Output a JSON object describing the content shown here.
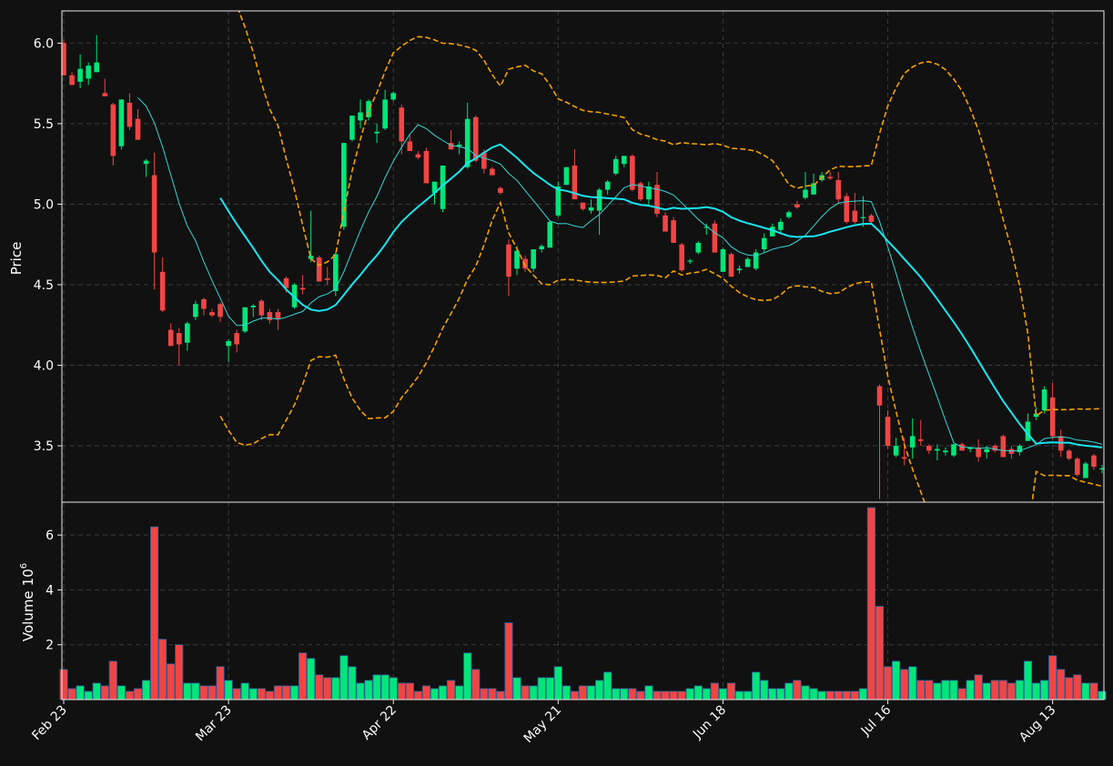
{
  "chart_data": {
    "type": "candlestick",
    "colors": {
      "background": "#111111",
      "up": "#00e67a",
      "down": "#f04545",
      "ma_fast": "#36d6d6",
      "ma_slow": "#19e5f0",
      "bollinger": "#f5a000",
      "grid": "#3a3a3a"
    },
    "price_panel": {
      "ylabel": "Price",
      "ylim": [
        3.15,
        6.2
      ],
      "yticks": [
        3.5,
        4.0,
        4.5,
        5.0,
        5.5,
        6.0
      ],
      "ytick_labels": [
        "3.5",
        "4.0",
        "4.5",
        "5.0",
        "5.5",
        "6.0"
      ]
    },
    "volume_panel": {
      "ylabel": "Volume",
      "ylabel_exp": "6",
      "ylim": [
        0,
        7.0
      ],
      "yticks": [
        2,
        4,
        6
      ],
      "ytick_labels": [
        "2",
        "4",
        "6"
      ]
    },
    "x_tick_labels": [
      {
        "index": 0,
        "label": "Feb 23"
      },
      {
        "index": 20,
        "label": "Mar 23"
      },
      {
        "index": 40,
        "label": "Apr 22"
      },
      {
        "index": 60,
        "label": "May 21"
      },
      {
        "index": 80,
        "label": "Jun 18"
      },
      {
        "index": 100,
        "label": "Jul 16"
      },
      {
        "index": 120,
        "label": "Aug 13"
      }
    ],
    "candles": [
      [
        6.0,
        6.02,
        5.8,
        5.8,
        1.1
      ],
      [
        5.8,
        5.82,
        5.74,
        5.74,
        0.4
      ],
      [
        5.76,
        5.93,
        5.72,
        5.84,
        0.5
      ],
      [
        5.78,
        5.88,
        5.74,
        5.86,
        0.3
      ],
      [
        5.82,
        6.05,
        5.82,
        5.88,
        0.6
      ],
      [
        5.69,
        5.78,
        5.67,
        5.67,
        0.5
      ],
      [
        5.62,
        5.63,
        5.24,
        5.3,
        1.4
      ],
      [
        5.36,
        5.65,
        5.34,
        5.65,
        0.5
      ],
      [
        5.63,
        5.69,
        5.46,
        5.48,
        0.3
      ],
      [
        5.53,
        5.59,
        5.41,
        5.4,
        0.4
      ],
      [
        5.25,
        5.28,
        5.17,
        5.27,
        0.7
      ],
      [
        5.18,
        5.32,
        4.47,
        4.7,
        6.3
      ],
      [
        4.58,
        4.67,
        4.33,
        4.34,
        2.2
      ],
      [
        4.22,
        4.26,
        4.19,
        4.12,
        1.3
      ],
      [
        4.2,
        4.23,
        4.0,
        4.13,
        2.0
      ],
      [
        4.14,
        4.27,
        4.09,
        4.26,
        0.6
      ],
      [
        4.3,
        4.4,
        4.28,
        4.38,
        0.6
      ],
      [
        4.41,
        4.42,
        4.31,
        4.35,
        0.5
      ],
      [
        4.33,
        4.35,
        4.3,
        4.31,
        0.5
      ],
      [
        4.38,
        4.39,
        4.27,
        4.3,
        1.2
      ],
      [
        4.12,
        4.16,
        4.02,
        4.15,
        0.7
      ],
      [
        4.2,
        4.22,
        4.08,
        4.13,
        0.4
      ],
      [
        4.21,
        4.36,
        4.2,
        4.36,
        0.6
      ],
      [
        4.36,
        4.38,
        4.3,
        4.37,
        0.4
      ],
      [
        4.4,
        4.41,
        4.28,
        4.31,
        0.4
      ],
      [
        4.33,
        4.35,
        4.26,
        4.28,
        0.3
      ],
      [
        4.33,
        4.35,
        4.22,
        4.29,
        0.5
      ],
      [
        4.54,
        4.55,
        4.45,
        4.48,
        0.5
      ],
      [
        4.36,
        4.51,
        4.35,
        4.5,
        0.5
      ],
      [
        4.48,
        4.56,
        4.44,
        4.47,
        1.7
      ],
      [
        4.66,
        4.96,
        4.64,
        4.68,
        1.5
      ],
      [
        4.67,
        4.68,
        4.56,
        4.52,
        0.9
      ],
      [
        4.54,
        4.61,
        4.5,
        4.53,
        0.8
      ],
      [
        4.46,
        4.7,
        4.43,
        4.69,
        0.8
      ],
      [
        4.86,
        5.38,
        4.84,
        5.38,
        1.6
      ],
      [
        5.4,
        5.55,
        5.39,
        5.55,
        1.2
      ],
      [
        5.52,
        5.65,
        5.47,
        5.57,
        0.6
      ],
      [
        5.54,
        5.65,
        5.52,
        5.64,
        0.7
      ],
      [
        5.44,
        5.5,
        5.38,
        5.45,
        0.9
      ],
      [
        5.47,
        5.71,
        5.46,
        5.65,
        0.9
      ],
      [
        5.65,
        5.7,
        5.64,
        5.69,
        0.8
      ],
      [
        5.6,
        5.62,
        5.31,
        5.39,
        0.6
      ],
      [
        5.39,
        5.43,
        5.33,
        5.33,
        0.6
      ],
      [
        5.31,
        5.33,
        5.28,
        5.29,
        0.3
      ],
      [
        5.33,
        5.35,
        5.13,
        5.13,
        0.5
      ],
      [
        5.07,
        5.14,
        5.0,
        5.14,
        0.4
      ],
      [
        4.97,
        5.24,
        4.95,
        5.24,
        0.5
      ],
      [
        5.38,
        5.46,
        5.34,
        5.34,
        0.7
      ],
      [
        5.36,
        5.39,
        5.31,
        5.37,
        0.5
      ],
      [
        5.23,
        5.63,
        5.22,
        5.53,
        1.7
      ],
      [
        5.54,
        5.55,
        5.26,
        5.27,
        1.1
      ],
      [
        5.32,
        5.34,
        5.19,
        5.22,
        0.4
      ],
      [
        5.22,
        5.23,
        5.2,
        5.18,
        0.4
      ],
      [
        5.1,
        5.11,
        5.06,
        5.07,
        0.3
      ],
      [
        4.75,
        4.78,
        4.43,
        4.55,
        2.8
      ],
      [
        4.6,
        4.74,
        4.56,
        4.71,
        0.8
      ],
      [
        4.66,
        4.68,
        4.58,
        4.6,
        0.5
      ],
      [
        4.6,
        4.72,
        4.58,
        4.72,
        0.5
      ],
      [
        4.72,
        4.75,
        4.7,
        4.74,
        0.8
      ],
      [
        4.73,
        4.9,
        4.73,
        4.89,
        0.8
      ],
      [
        4.93,
        5.14,
        4.92,
        5.11,
        1.2
      ],
      [
        5.12,
        5.23,
        5.13,
        5.23,
        0.5
      ],
      [
        5.24,
        5.34,
        5.03,
        5.03,
        0.3
      ],
      [
        5.01,
        5.0,
        4.96,
        4.97,
        0.5
      ],
      [
        4.96,
        5.03,
        4.94,
        4.98,
        0.5
      ],
      [
        4.96,
        5.1,
        4.81,
        5.09,
        0.7
      ],
      [
        5.09,
        5.15,
        5.06,
        5.14,
        1.0
      ],
      [
        5.19,
        5.3,
        5.18,
        5.28,
        0.4
      ],
      [
        5.25,
        5.3,
        5.23,
        5.3,
        0.4
      ],
      [
        5.3,
        5.31,
        5.08,
        5.09,
        0.4
      ],
      [
        5.13,
        5.14,
        5.02,
        5.03,
        0.3
      ],
      [
        5.03,
        5.14,
        4.99,
        5.11,
        0.5
      ],
      [
        5.12,
        5.2,
        4.92,
        4.94,
        0.3
      ],
      [
        4.93,
        4.95,
        4.83,
        4.83,
        0.3
      ],
      [
        4.9,
        4.92,
        4.76,
        4.76,
        0.3
      ],
      [
        4.75,
        4.76,
        4.58,
        4.59,
        0.3
      ],
      [
        4.65,
        4.66,
        4.63,
        4.65,
        0.4
      ],
      [
        4.7,
        4.77,
        4.69,
        4.76,
        0.5
      ],
      [
        4.86,
        4.88,
        4.81,
        4.86,
        0.4
      ],
      [
        4.88,
        4.9,
        4.7,
        4.7,
        0.6
      ],
      [
        4.58,
        4.73,
        4.58,
        4.72,
        0.4
      ],
      [
        4.69,
        4.7,
        4.56,
        4.55,
        0.6
      ],
      [
        4.59,
        4.62,
        4.57,
        4.6,
        0.3
      ],
      [
        4.61,
        4.67,
        4.62,
        4.66,
        0.3
      ],
      [
        4.6,
        4.72,
        4.59,
        4.7,
        1.0
      ],
      [
        4.72,
        4.82,
        4.7,
        4.79,
        0.7
      ],
      [
        4.8,
        4.88,
        4.8,
        4.86,
        0.4
      ],
      [
        4.84,
        4.91,
        4.82,
        4.89,
        0.4
      ],
      [
        4.92,
        4.96,
        4.91,
        4.95,
        0.6
      ],
      [
        5.0,
        5.02,
        4.97,
        4.98,
        0.7
      ],
      [
        5.04,
        5.2,
        5.03,
        5.09,
        0.5
      ],
      [
        5.06,
        5.19,
        5.07,
        5.13,
        0.4
      ],
      [
        5.15,
        5.2,
        5.14,
        5.18,
        0.3
      ],
      [
        5.17,
        5.2,
        5.15,
        5.16,
        0.3
      ],
      [
        5.15,
        5.2,
        5.0,
        5.03,
        0.3
      ],
      [
        5.05,
        5.07,
        4.88,
        4.89,
        0.3
      ],
      [
        4.96,
        5.07,
        4.88,
        4.89,
        0.3
      ],
      [
        4.92,
        5.05,
        4.86,
        4.92,
        0.4
      ],
      [
        4.93,
        4.94,
        4.88,
        4.89,
        7.0
      ],
      [
        3.87,
        3.88,
        3.17,
        3.75,
        3.4
      ],
      [
        3.68,
        3.72,
        3.48,
        3.5,
        1.2
      ],
      [
        3.44,
        3.55,
        3.43,
        3.5,
        1.4
      ],
      [
        3.43,
        3.55,
        3.38,
        3.42,
        1.1
      ],
      [
        3.49,
        3.67,
        3.42,
        3.56,
        1.2
      ],
      [
        3.54,
        3.66,
        3.5,
        3.53,
        0.7
      ],
      [
        3.5,
        3.51,
        3.45,
        3.47,
        0.7
      ],
      [
        3.47,
        3.51,
        3.41,
        3.48,
        0.6
      ],
      [
        3.46,
        3.49,
        3.44,
        3.47,
        0.7
      ],
      [
        3.44,
        3.51,
        3.43,
        3.51,
        0.7
      ],
      [
        3.51,
        3.52,
        3.47,
        3.47,
        0.4
      ],
      [
        3.48,
        3.49,
        3.46,
        3.49,
        0.7
      ],
      [
        3.49,
        3.54,
        3.4,
        3.43,
        0.9
      ],
      [
        3.46,
        3.5,
        3.42,
        3.48,
        0.6
      ],
      [
        3.5,
        3.51,
        3.46,
        3.47,
        0.7
      ],
      [
        3.56,
        3.57,
        3.43,
        3.43,
        0.7
      ],
      [
        3.48,
        3.5,
        3.42,
        3.45,
        0.6
      ],
      [
        3.46,
        3.51,
        3.44,
        3.5,
        0.7
      ],
      [
        3.53,
        3.7,
        3.53,
        3.65,
        1.4
      ],
      [
        3.68,
        3.74,
        3.66,
        3.7,
        0.6
      ],
      [
        3.72,
        3.87,
        3.7,
        3.85,
        0.7
      ],
      [
        3.8,
        3.89,
        3.54,
        3.56,
        1.6
      ],
      [
        3.56,
        3.6,
        3.43,
        3.47,
        1.1
      ],
      [
        3.47,
        3.48,
        3.41,
        3.42,
        0.8
      ],
      [
        3.42,
        3.43,
        3.31,
        3.32,
        0.9
      ],
      [
        3.3,
        3.4,
        3.31,
        3.39,
        0.6
      ],
      [
        3.44,
        3.45,
        3.35,
        3.37,
        0.6
      ],
      [
        3.36,
        3.38,
        3.33,
        3.36,
        0.3
      ]
    ]
  }
}
